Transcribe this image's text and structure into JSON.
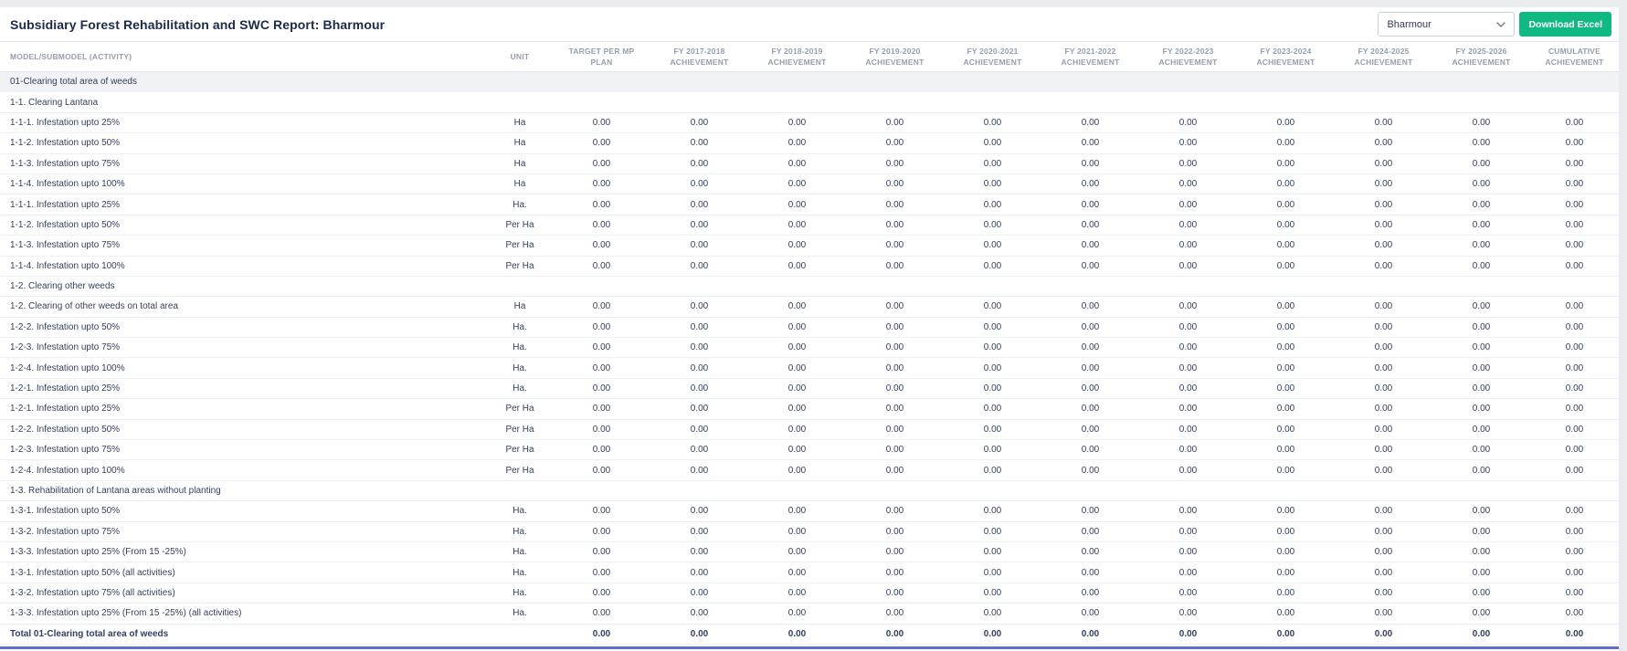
{
  "page": {
    "title": "Subsidiary Forest Rehabilitation and SWC Report: Bharmour",
    "region_select": {
      "value": "Bharmour"
    },
    "download_button": "Download Excel",
    "colors": {
      "button_green": "#10b981",
      "section_row_bg": "#f1f2f5",
      "bottom_accent": "#5b6fc9",
      "header_text": "#949eae",
      "body_text": "#33415e"
    }
  },
  "table": {
    "columns": [
      "MODEL/SUBMODEL (ACTIVITY)",
      "UNIT",
      "TARGET PER MP\nPLAN",
      "FY 2017-2018\nACHIEVEMENT",
      "FY 2018-2019\nACHIEVEMENT",
      "FY 2019-2020\nACHIEVEMENT",
      "FY 2020-2021\nACHIEVEMENT",
      "FY 2021-2022\nACHIEVEMENT",
      "FY 2022-2023\nACHIEVEMENT",
      "FY 2023-2024\nACHIEVEMENT",
      "FY 2024-2025\nACHIEVEMENT",
      "FY 2025-2026\nACHIEVEMENT",
      "CUMULATIVE\nACHIEVEMENT"
    ],
    "rows": [
      {
        "type": "section-main",
        "label": "01-Clearing total area of weeds"
      },
      {
        "type": "section-sub",
        "label": "1-1. Clearing Lantana"
      },
      {
        "type": "item",
        "label": "1-1-1. Infestation upto 25%",
        "unit": "Ha",
        "values": [
          "0.00",
          "0.00",
          "0.00",
          "0.00",
          "0.00",
          "0.00",
          "0.00",
          "0.00",
          "0.00",
          "0.00",
          "0.00"
        ]
      },
      {
        "type": "item",
        "label": "1-1-2. Infestation upto 50%",
        "unit": "Ha",
        "values": [
          "0.00",
          "0.00",
          "0.00",
          "0.00",
          "0.00",
          "0.00",
          "0.00",
          "0.00",
          "0.00",
          "0.00",
          "0.00"
        ]
      },
      {
        "type": "item",
        "label": "1-1-3. Infestation upto 75%",
        "unit": "Ha",
        "values": [
          "0.00",
          "0.00",
          "0.00",
          "0.00",
          "0.00",
          "0.00",
          "0.00",
          "0.00",
          "0.00",
          "0.00",
          "0.00"
        ]
      },
      {
        "type": "item",
        "label": "1-1-4. Infestation upto 100%",
        "unit": "Ha",
        "values": [
          "0.00",
          "0.00",
          "0.00",
          "0.00",
          "0.00",
          "0.00",
          "0.00",
          "0.00",
          "0.00",
          "0.00",
          "0.00"
        ]
      },
      {
        "type": "item",
        "label": "1-1-1. Infestation upto 25%",
        "unit": "Ha.",
        "values": [
          "0.00",
          "0.00",
          "0.00",
          "0.00",
          "0.00",
          "0.00",
          "0.00",
          "0.00",
          "0.00",
          "0.00",
          "0.00"
        ]
      },
      {
        "type": "item",
        "label": "1-1-2. Infestation upto 50%",
        "unit": "Per Ha",
        "values": [
          "0.00",
          "0.00",
          "0.00",
          "0.00",
          "0.00",
          "0.00",
          "0.00",
          "0.00",
          "0.00",
          "0.00",
          "0.00"
        ]
      },
      {
        "type": "item",
        "label": "1-1-3. Infestation upto 75%",
        "unit": "Per Ha",
        "values": [
          "0.00",
          "0.00",
          "0.00",
          "0.00",
          "0.00",
          "0.00",
          "0.00",
          "0.00",
          "0.00",
          "0.00",
          "0.00"
        ]
      },
      {
        "type": "item",
        "label": "1-1-4. Infestation upto 100%",
        "unit": "Per Ha",
        "values": [
          "0.00",
          "0.00",
          "0.00",
          "0.00",
          "0.00",
          "0.00",
          "0.00",
          "0.00",
          "0.00",
          "0.00",
          "0.00"
        ]
      },
      {
        "type": "section-sub",
        "label": "1-2. Clearing other weeds"
      },
      {
        "type": "item",
        "label": "1-2. Clearing of other weeds on total area",
        "unit": "Ha",
        "values": [
          "0.00",
          "0.00",
          "0.00",
          "0.00",
          "0.00",
          "0.00",
          "0.00",
          "0.00",
          "0.00",
          "0.00",
          "0.00"
        ]
      },
      {
        "type": "item",
        "label": "1-2-2. Infestation upto 50%",
        "unit": "Ha.",
        "values": [
          "0.00",
          "0.00",
          "0.00",
          "0.00",
          "0.00",
          "0.00",
          "0.00",
          "0.00",
          "0.00",
          "0.00",
          "0.00"
        ]
      },
      {
        "type": "item",
        "label": "1-2-3. Infestation upto 75%",
        "unit": "Ha.",
        "values": [
          "0.00",
          "0.00",
          "0.00",
          "0.00",
          "0.00",
          "0.00",
          "0.00",
          "0.00",
          "0.00",
          "0.00",
          "0.00"
        ]
      },
      {
        "type": "item",
        "label": "1-2-4. Infestation upto 100%",
        "unit": "Ha.",
        "values": [
          "0.00",
          "0.00",
          "0.00",
          "0.00",
          "0.00",
          "0.00",
          "0.00",
          "0.00",
          "0.00",
          "0.00",
          "0.00"
        ]
      },
      {
        "type": "item",
        "label": "1-2-1. Infestation upto 25%",
        "unit": "Ha.",
        "values": [
          "0.00",
          "0.00",
          "0.00",
          "0.00",
          "0.00",
          "0.00",
          "0.00",
          "0.00",
          "0.00",
          "0.00",
          "0.00"
        ]
      },
      {
        "type": "item",
        "label": "1-2-1. Infestation upto 25%",
        "unit": "Per Ha",
        "values": [
          "0.00",
          "0.00",
          "0.00",
          "0.00",
          "0.00",
          "0.00",
          "0.00",
          "0.00",
          "0.00",
          "0.00",
          "0.00"
        ]
      },
      {
        "type": "item",
        "label": "1-2-2. Infestation upto 50%",
        "unit": "Per Ha",
        "values": [
          "0.00",
          "0.00",
          "0.00",
          "0.00",
          "0.00",
          "0.00",
          "0.00",
          "0.00",
          "0.00",
          "0.00",
          "0.00"
        ]
      },
      {
        "type": "item",
        "label": "1-2-3. Infestation upto 75%",
        "unit": "Per Ha",
        "values": [
          "0.00",
          "0.00",
          "0.00",
          "0.00",
          "0.00",
          "0.00",
          "0.00",
          "0.00",
          "0.00",
          "0.00",
          "0.00"
        ]
      },
      {
        "type": "item",
        "label": "1-2-4. Infestation upto 100%",
        "unit": "Per Ha",
        "values": [
          "0.00",
          "0.00",
          "0.00",
          "0.00",
          "0.00",
          "0.00",
          "0.00",
          "0.00",
          "0.00",
          "0.00",
          "0.00"
        ]
      },
      {
        "type": "section-sub",
        "label": "1-3. Rehabilitation of Lantana areas without planting"
      },
      {
        "type": "item",
        "label": "1-3-1. Infestation upto 50%",
        "unit": "Ha.",
        "values": [
          "0.00",
          "0.00",
          "0.00",
          "0.00",
          "0.00",
          "0.00",
          "0.00",
          "0.00",
          "0.00",
          "0.00",
          "0.00"
        ]
      },
      {
        "type": "item",
        "label": "1-3-2. Infestation upto 75%",
        "unit": "Ha.",
        "values": [
          "0.00",
          "0.00",
          "0.00",
          "0.00",
          "0.00",
          "0.00",
          "0.00",
          "0.00",
          "0.00",
          "0.00",
          "0.00"
        ]
      },
      {
        "type": "item",
        "label": "1-3-3. Infestation upto 25% (From 15 -25%)",
        "unit": "Ha.",
        "values": [
          "0.00",
          "0.00",
          "0.00",
          "0.00",
          "0.00",
          "0.00",
          "0.00",
          "0.00",
          "0.00",
          "0.00",
          "0.00"
        ]
      },
      {
        "type": "item",
        "label": "1-3-1. Infestation upto 50% (all activities)",
        "unit": "Ha.",
        "values": [
          "0.00",
          "0.00",
          "0.00",
          "0.00",
          "0.00",
          "0.00",
          "0.00",
          "0.00",
          "0.00",
          "0.00",
          "0.00"
        ]
      },
      {
        "type": "item",
        "label": "1-3-2. Infestation upto 75% (all activities)",
        "unit": "Ha.",
        "values": [
          "0.00",
          "0.00",
          "0.00",
          "0.00",
          "0.00",
          "0.00",
          "0.00",
          "0.00",
          "0.00",
          "0.00",
          "0.00"
        ]
      },
      {
        "type": "item",
        "label": "1-3-3. Infestation upto 25% (From 15 -25%) (all activities)",
        "unit": "Ha.",
        "values": [
          "0.00",
          "0.00",
          "0.00",
          "0.00",
          "0.00",
          "0.00",
          "0.00",
          "0.00",
          "0.00",
          "0.00",
          "0.00"
        ]
      },
      {
        "type": "total",
        "label": "Total 01-Clearing total area of weeds",
        "values": [
          "0.00",
          "0.00",
          "0.00",
          "0.00",
          "0.00",
          "0.00",
          "0.00",
          "0.00",
          "0.00",
          "0.00",
          "0.00"
        ]
      }
    ]
  }
}
